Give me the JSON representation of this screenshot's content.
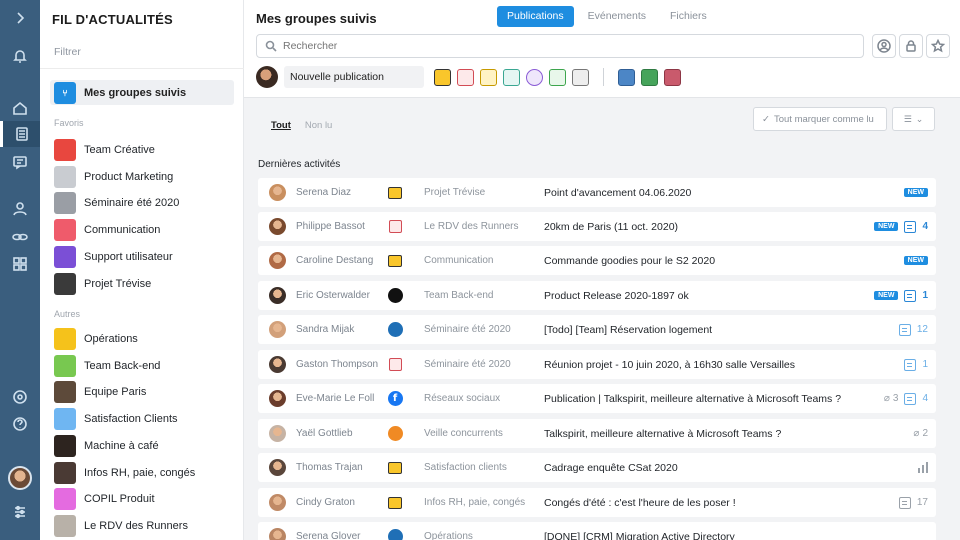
{
  "rail": {
    "icons": [
      "chevron-right-icon",
      "bell-icon",
      "home-icon",
      "feed-icon",
      "chat-icon",
      "people-icon",
      "link-icon",
      "apps-icon",
      "help-circle-icon",
      "question-icon",
      "sliders-icon"
    ]
  },
  "sidebar": {
    "title": "FIL D'ACTUALITÉS",
    "filter_label": "Filtrer",
    "active_item": "Mes groupes suivis",
    "favoris_label": "Favoris",
    "autres_label": "Autres",
    "favoris": [
      {
        "label": "Team Créative",
        "color": "#e8473f"
      },
      {
        "label": "Product Marketing",
        "color": "#c9ccd1"
      },
      {
        "label": "Séminaire été 2020",
        "color": "#9a9ea5"
      },
      {
        "label": "Communication",
        "color": "#ef5b6b"
      },
      {
        "label": "Support utilisateur",
        "color": "#7b4fd6"
      },
      {
        "label": "Projet Trévise",
        "color": "#3a3a3a"
      }
    ],
    "autres": [
      {
        "label": "Opérations",
        "color": "#f5c21b"
      },
      {
        "label": "Team Back-end",
        "color": "#78c850"
      },
      {
        "label": "Equipe Paris",
        "color": "#5d4a3a"
      },
      {
        "label": "Satisfaction Clients",
        "color": "#6fb6f2"
      },
      {
        "label": "Machine à café",
        "color": "#2d241f"
      },
      {
        "label": "Infos RH, paie, congés",
        "color": "#4a3a34"
      },
      {
        "label": "COPIL Produit",
        "color": "#e46be0"
      },
      {
        "label": "Le RDV des Runners",
        "color": "#b8b1a8"
      }
    ]
  },
  "header": {
    "title": "Mes groupes suivis",
    "tabs": [
      "Publications",
      "Evénements",
      "Fichiers"
    ],
    "search_placeholder": "Rechercher",
    "new_post_label": "Nouvelle publication"
  },
  "feed": {
    "subtab_all": "Tout",
    "subtab_unread": "Non lu",
    "mark_all": "Tout marquer comme lu",
    "section_title": "Dernières activités",
    "new_badge": "NEW",
    "rows": [
      {
        "author": "Serena Diaz",
        "src": "post",
        "group": "Projet Trévise",
        "title": "Point d'avancement 04.06.2020",
        "new": true,
        "comments": "",
        "attach": ""
      },
      {
        "author": "Philippe Bassot",
        "src": "cal",
        "group": "Le RDV des Runners",
        "title": "20km de Paris (11 oct. 2020)",
        "new": true,
        "comments": "4",
        "attach": ""
      },
      {
        "author": "Caroline Destang",
        "src": "post",
        "group": "Communication",
        "title": "Commande goodies pour le S2 2020",
        "new": true,
        "comments": "",
        "attach": ""
      },
      {
        "author": "Eric Osterwalder",
        "src": "gh",
        "group": "Team Back-end",
        "title": "Product Release 2020-1897 ok",
        "new": true,
        "comments": "1",
        "attach": ""
      },
      {
        "author": "Sandra Mijak",
        "src": "trello",
        "group": "Séminaire été 2020",
        "title": "[Todo] [Team] Réservation logement",
        "new": false,
        "comments": "12",
        "attach": ""
      },
      {
        "author": "Gaston Thompson",
        "src": "cal",
        "group": "Séminaire été 2020",
        "title": "Réunion projet - 10 juin 2020, à 16h30 salle Versailles",
        "new": false,
        "comments": "1",
        "attach": ""
      },
      {
        "author": "Eve-Marie Le Foll",
        "src": "fb",
        "group": "Réseaux sociaux",
        "title": "Publication | Talkspirit, meilleure alternative à Microsoft Teams ?",
        "new": false,
        "comments": "4",
        "attach": "3"
      },
      {
        "author": "Yaël Gottlieb",
        "src": "rss",
        "group": "Veille concurrents",
        "title": "Talkspirit, meilleure alternative à Microsoft Teams ?",
        "new": false,
        "comments": "",
        "attach": "2"
      },
      {
        "author": "Thomas Trajan",
        "src": "post",
        "group": "Satisfaction clients",
        "title": "Cadrage enquête CSat 2020",
        "new": false,
        "comments": "",
        "attach": "",
        "poll": true
      },
      {
        "author": "Cindy Graton",
        "src": "post",
        "group": "Infos RH, paie, congés",
        "title": "Congés d'été : c'est l'heure de les poser !",
        "new": false,
        "comments": "17",
        "attach": "",
        "grey": true
      },
      {
        "author": "Serena Glover",
        "src": "trello",
        "group": "Opérations",
        "title": "[DONE] [CRM] Migration Active Directory",
        "new": false,
        "comments": "",
        "attach": ""
      }
    ]
  }
}
